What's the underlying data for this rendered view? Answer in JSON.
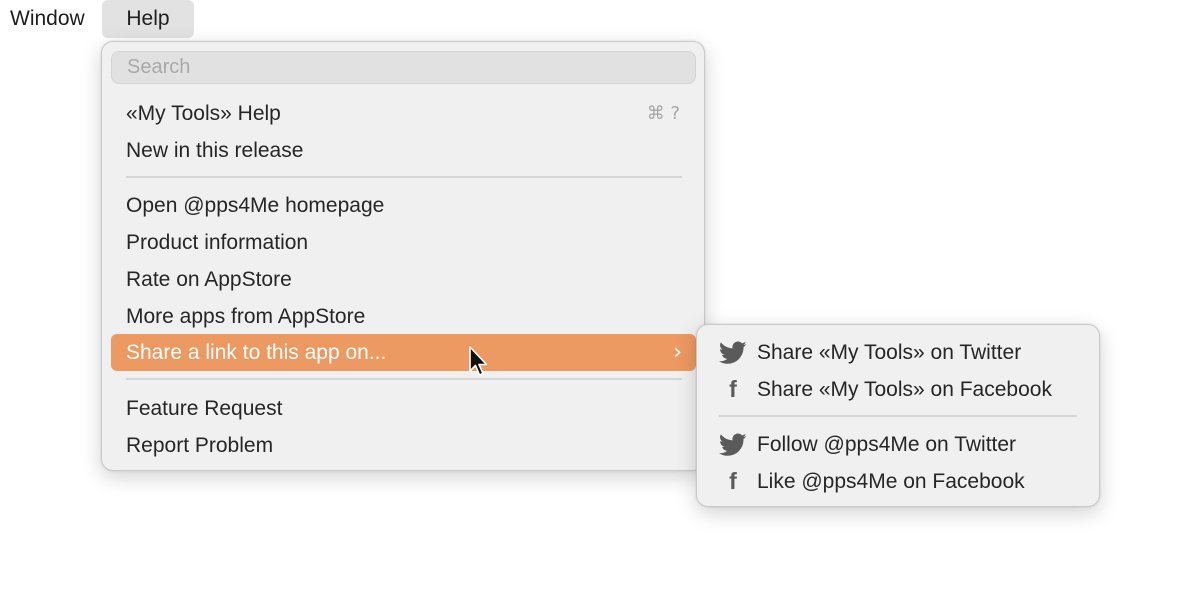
{
  "menubar": {
    "window_label": "Window",
    "help_label": "Help"
  },
  "help_menu": {
    "search_placeholder": "Search",
    "items": [
      {
        "label": "«My Tools» Help",
        "shortcut": "⌘ ?"
      },
      {
        "label": "New in this release"
      },
      {
        "label": "Open @pps4Me homepage"
      },
      {
        "label": "Product information"
      },
      {
        "label": "Rate on AppStore"
      },
      {
        "label": "More apps from AppStore"
      },
      {
        "label": "Share a link to this app on...",
        "has_submenu": true,
        "highlighted": true
      },
      {
        "label": "Feature Request"
      },
      {
        "label": "Report Problem"
      }
    ],
    "highlight_color": "#ec9962"
  },
  "share_submenu": {
    "items": [
      {
        "label": "Share «My Tools» on Twitter",
        "icon": "twitter-icon"
      },
      {
        "label": "Share «My Tools» on Facebook",
        "icon": "facebook-icon"
      },
      {
        "label": "Follow @pps4Me on Twitter",
        "icon": "twitter-icon"
      },
      {
        "label": "Like @pps4Me on Facebook",
        "icon": "facebook-icon"
      }
    ]
  }
}
